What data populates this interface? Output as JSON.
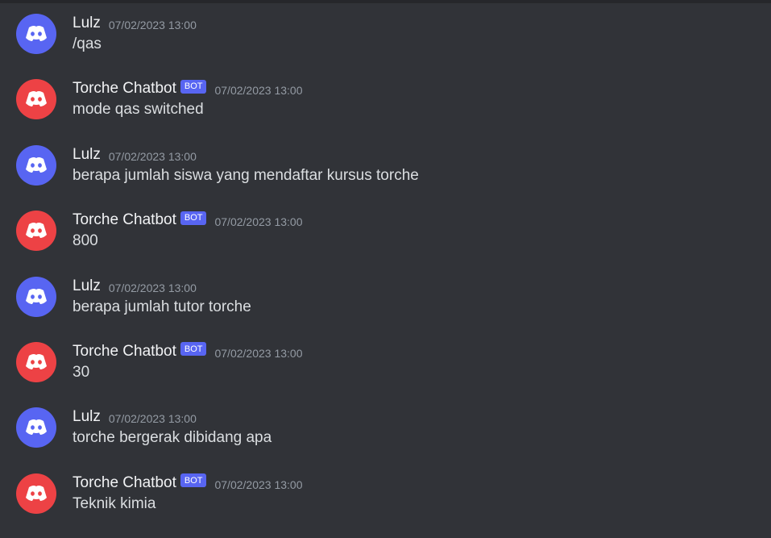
{
  "colors": {
    "user_avatar": "#5865f2",
    "bot_avatar": "#ed4245",
    "bot_tag": "#5865f2",
    "background": "#313338"
  },
  "messages": [
    {
      "author": "Lulz",
      "is_bot": false,
      "timestamp": "07/02/2023 13:00",
      "text": "/qas",
      "avatar_icon": "discord-logo-icon"
    },
    {
      "author": "Torche Chatbot",
      "is_bot": true,
      "bot_tag": "BOT",
      "timestamp": "07/02/2023 13:00",
      "text": "mode qas switched",
      "avatar_icon": "discord-logo-icon"
    },
    {
      "author": "Lulz",
      "is_bot": false,
      "timestamp": "07/02/2023 13:00",
      "text": "berapa jumlah siswa yang mendaftar kursus torche",
      "avatar_icon": "discord-logo-icon"
    },
    {
      "author": "Torche Chatbot",
      "is_bot": true,
      "bot_tag": "BOT",
      "timestamp": "07/02/2023 13:00",
      "text": "800",
      "avatar_icon": "discord-logo-icon"
    },
    {
      "author": "Lulz",
      "is_bot": false,
      "timestamp": "07/02/2023 13:00",
      "text": "berapa jumlah tutor torche",
      "avatar_icon": "discord-logo-icon"
    },
    {
      "author": "Torche Chatbot",
      "is_bot": true,
      "bot_tag": "BOT",
      "timestamp": "07/02/2023 13:00",
      "text": "30",
      "avatar_icon": "discord-logo-icon"
    },
    {
      "author": "Lulz",
      "is_bot": false,
      "timestamp": "07/02/2023 13:00",
      "text": "torche bergerak dibidang apa",
      "avatar_icon": "discord-logo-icon"
    },
    {
      "author": "Torche Chatbot",
      "is_bot": true,
      "bot_tag": "BOT",
      "timestamp": "07/02/2023 13:00",
      "text": "Teknik kimia",
      "avatar_icon": "discord-logo-icon"
    }
  ]
}
